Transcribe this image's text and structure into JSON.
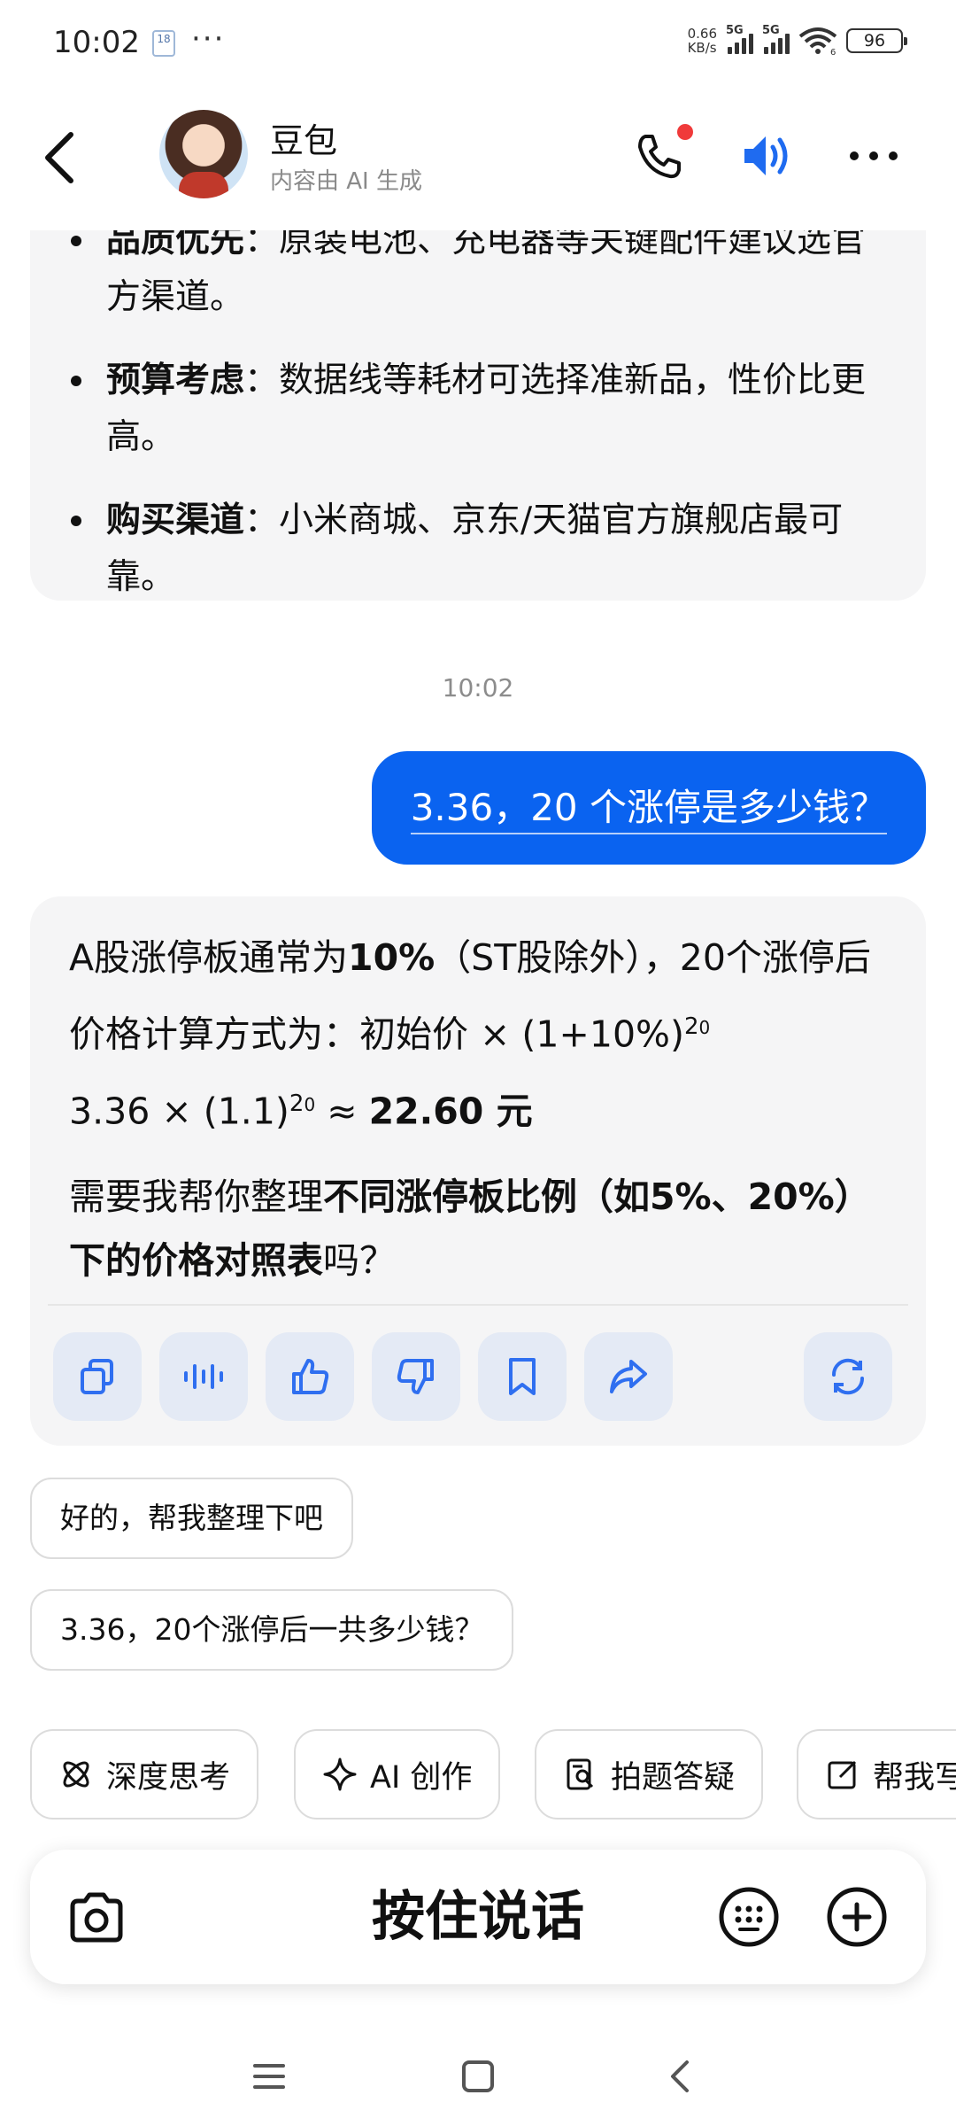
{
  "status_bar": {
    "time": "10:02",
    "notif_badge": "18",
    "dots": "···",
    "net_speed_value": "0.66",
    "net_speed_unit": "KB/s",
    "sim1": "5G",
    "sim2": "5G",
    "wifi_sub": "6",
    "battery": "96"
  },
  "header": {
    "bot_name": "豆包",
    "bot_sub": "内容由 AI 生成"
  },
  "ai_prev": {
    "bullets": [
      {
        "bold": "品质优先",
        "text": "：原装电池、充电器等关键配件建议选官方渠道。"
      },
      {
        "bold": "预算考虑",
        "text": "：数据线等耗材可选择准新品，性价比更高。"
      },
      {
        "bold": "购买渠道",
        "text": "：小米商城、京东/天猫官方旗舰店最可靠。"
      }
    ]
  },
  "timestamp": "10:02",
  "user_message": "3.36，20 个涨停是多少钱？",
  "ai_reply": {
    "line1_pre": "A股涨停板通常为",
    "line1_bold": "10%",
    "line1_post": "（ST股除外），20个涨停后价格计算方式为：初始价 × (1+10%)",
    "exp1": "2",
    "sub1": "0",
    "line2_pre": "3.36 × (1.1)",
    "exp2": "2",
    "sub2": "0",
    "line2_mid": " ≈ ",
    "line2_bold": "22.60 元",
    "para2_pre": "需要我帮你整理",
    "para2_bold": "不同涨停板比例（如5%、20%）下的价格对照表",
    "para2_post": "吗？"
  },
  "suggestions": [
    "好的，帮我整理下吧",
    "3.36，20个涨停后一共多少钱？"
  ],
  "tools": [
    {
      "label": "深度思考",
      "icon": "atom-icon"
    },
    {
      "label": "AI 创作",
      "icon": "sparkle-icon"
    },
    {
      "label": "拍题答疑",
      "icon": "photo-search-icon"
    },
    {
      "label": "帮我写",
      "icon": "edit-icon"
    }
  ],
  "input": {
    "hold_to_speak": "按住说话"
  }
}
